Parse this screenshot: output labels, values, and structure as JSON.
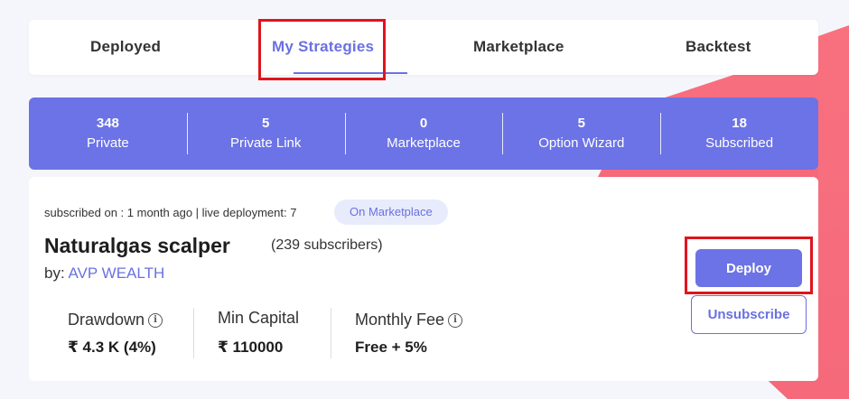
{
  "tabs": [
    {
      "label": "Deployed",
      "active": false
    },
    {
      "label": "My Strategies",
      "active": true
    },
    {
      "label": "Marketplace",
      "active": false
    },
    {
      "label": "Backtest",
      "active": false
    }
  ],
  "stats": [
    {
      "value": "348",
      "label": "Private"
    },
    {
      "value": "5",
      "label": "Private Link"
    },
    {
      "value": "0",
      "label": "Marketplace"
    },
    {
      "value": "5",
      "label": "Option Wizard"
    },
    {
      "value": "18",
      "label": "Subscribed"
    }
  ],
  "card": {
    "meta": "subscribed on : 1 month ago | live deployment: 7",
    "badge": "On Marketplace",
    "title": "Naturalgas scalper",
    "subscribers": "(239 subscribers)",
    "author_prefix": "by:",
    "author_name": "AVP WEALTH",
    "metrics": [
      {
        "label": "Drawdown",
        "value": "₹ 4.3 K (4%)",
        "info": true
      },
      {
        "label": "Min Capital",
        "value": "₹ 110000",
        "info": false
      },
      {
        "label": "Monthly Fee",
        "value": "Free + 5%",
        "info": true
      }
    ],
    "deploy_label": "Deploy",
    "unsubscribe_label": "Unsubscribe"
  },
  "colors": {
    "accent": "#6b73e6",
    "highlight": "#e0141d",
    "background_wedge": "#f56b7d"
  },
  "icons": {
    "info": "info-circle-icon"
  }
}
